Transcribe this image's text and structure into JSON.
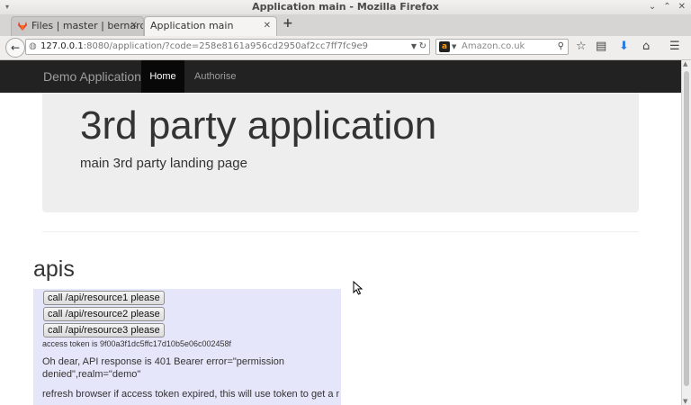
{
  "window": {
    "title": "Application main - Mozilla Firefox"
  },
  "tabs": [
    {
      "label": "Files | master | bernard...",
      "active": false,
      "icon": "gitlab-icon"
    },
    {
      "label": "Application main",
      "active": true
    }
  ],
  "navbar": {
    "url_host": "127.0.0.1",
    "url_rest": ":8080/application/?code=258e8161a956cd2950af2cc7ff7fc9e9",
    "search_placeholder": "Amazon.co.uk"
  },
  "app": {
    "brand": "Demo Application",
    "nav": [
      {
        "label": "Home",
        "active": true
      },
      {
        "label": "Authorise",
        "active": false
      }
    ],
    "jumbotron": {
      "title": "3rd party application",
      "subtitle": "main 3rd party landing page"
    },
    "apis": {
      "heading": "apis",
      "buttons": [
        "call /api/resource1 please",
        "call /api/resource2 please",
        "call /api/resource3 please"
      ],
      "token_text": "access token is 9f00a3f1dc5ffc17d10b5e06c002458f",
      "response_text": "Oh dear, API response is 401 Bearer error=\"permission denied\",realm=\"demo\"",
      "refresh_text": "refresh browser if access token expired, this will use token to get a new"
    }
  },
  "colors": {
    "app_navbar": "#222222",
    "nav_active": "#080808",
    "jumbotron": "#eeeeee",
    "apis_panel": "#e6e6fa"
  }
}
